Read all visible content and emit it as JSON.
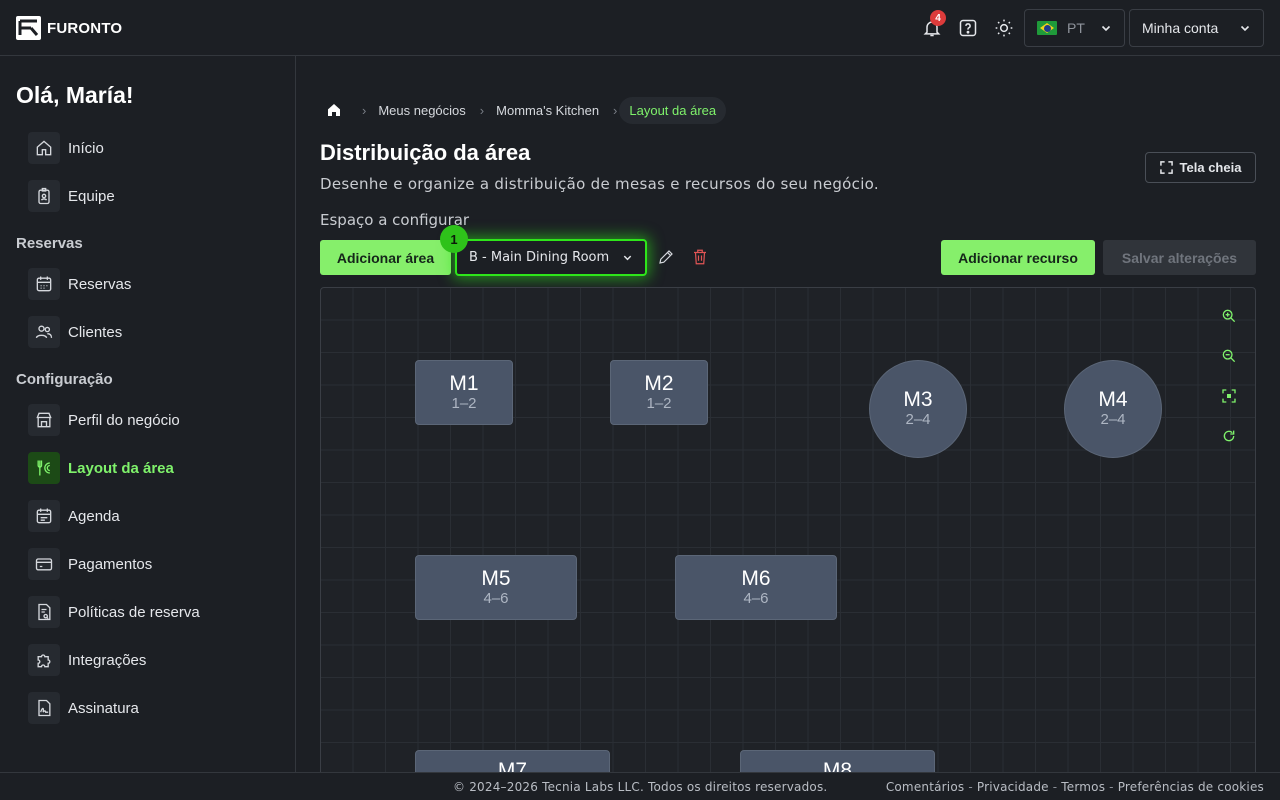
{
  "app": {
    "brand": "FURONTO"
  },
  "header": {
    "notifications_count": "4",
    "language": {
      "code": "PT",
      "flag": "brazil-flag"
    },
    "account_label": "Minha conta"
  },
  "sidebar": {
    "greeting": "Olá, María!",
    "items_top": [
      {
        "label": "Início",
        "icon": "home-icon"
      },
      {
        "label": "Equipe",
        "icon": "badge-icon"
      }
    ],
    "section_reservas": "Reservas",
    "items_reservas": [
      {
        "label": "Reservas",
        "icon": "calendar-icon"
      },
      {
        "label": "Clientes",
        "icon": "users-icon"
      }
    ],
    "section_config": "Configuração",
    "items_config": [
      {
        "label": "Perfil do negócio",
        "icon": "store-icon"
      },
      {
        "label": "Layout da área",
        "icon": "utensils-icon",
        "active": true
      },
      {
        "label": "Agenda",
        "icon": "schedule-icon"
      },
      {
        "label": "Pagamentos",
        "icon": "card-icon"
      },
      {
        "label": "Políticas de reserva",
        "icon": "policy-icon"
      },
      {
        "label": "Integrações",
        "icon": "puzzle-icon"
      },
      {
        "label": "Assinatura",
        "icon": "signature-icon"
      }
    ]
  },
  "breadcrumb": {
    "items": [
      "Meus negócios",
      "Momma's Kitchen"
    ],
    "current": "Layout da área"
  },
  "page": {
    "title": "Distribuição da área",
    "subtitle": "Desenhe e organize a distribuição de mesas e recursos do seu negócio.",
    "fullscreen_label": "Tela cheia",
    "space_label": "Espaço a configurar",
    "add_area_label": "Adicionar área",
    "selected_area": "B - Main Dining Room",
    "step_badge": "1",
    "add_resource_label": "Adicionar recurso",
    "save_label": "Salvar alterações"
  },
  "tables": [
    {
      "name": "M1",
      "capacity": "1–2",
      "shape": "rect"
    },
    {
      "name": "M2",
      "capacity": "1–2",
      "shape": "rect"
    },
    {
      "name": "M3",
      "capacity": "2–4",
      "shape": "round"
    },
    {
      "name": "M4",
      "capacity": "2–4",
      "shape": "round"
    },
    {
      "name": "M5",
      "capacity": "4–6",
      "shape": "rect"
    },
    {
      "name": "M6",
      "capacity": "4–6",
      "shape": "rect"
    },
    {
      "name": "M7",
      "capacity": "",
      "shape": "rect"
    },
    {
      "name": "M8",
      "capacity": "",
      "shape": "rect"
    }
  ],
  "footer": {
    "copyright": "© 2024–2026 Tecnia Labs LLC. Todos os direitos reservados.",
    "links": [
      "Comentários",
      "Privacidade",
      "Termos",
      "Preferências de cookies"
    ],
    "separator": "-"
  },
  "colors": {
    "accent": "#86ef6b",
    "active_text": "#7ff26b",
    "danger": "#e25555",
    "table_fill": "#4a5568",
    "background": "#1c1f24"
  }
}
